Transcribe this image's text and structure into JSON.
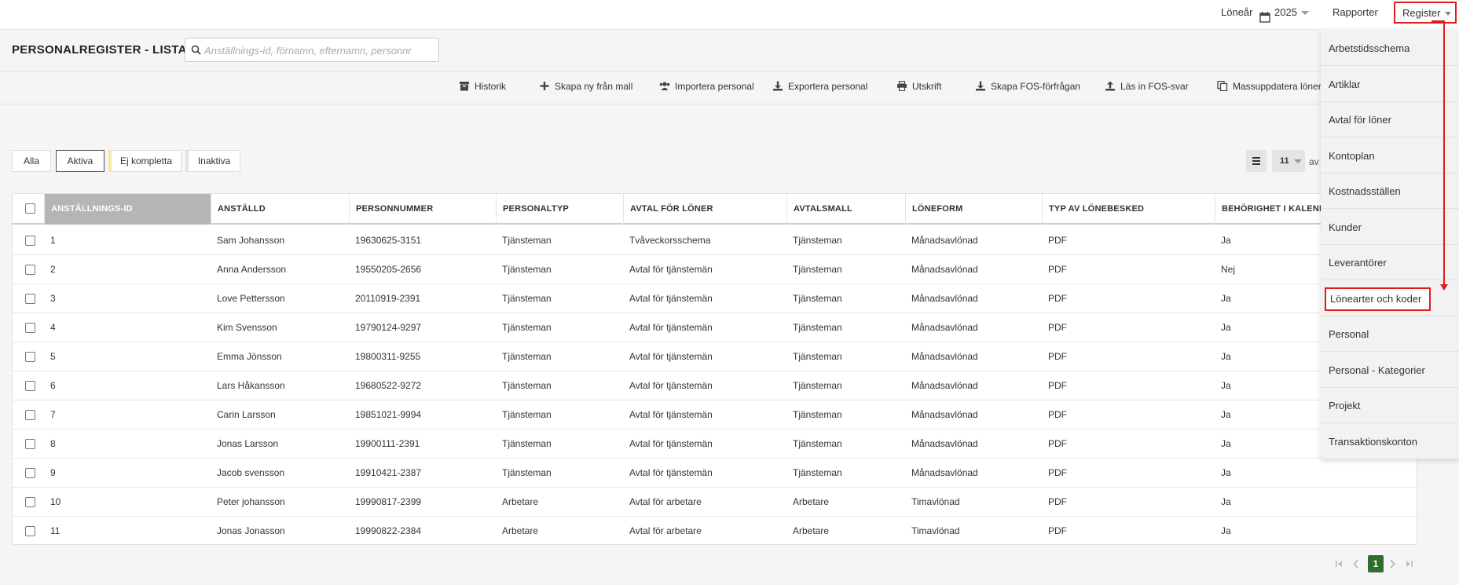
{
  "topbar": {
    "year_label": "Löneår",
    "year_value": "2025",
    "rapporter": "Rapporter",
    "register": "Register"
  },
  "page": {
    "title": "PERSONALREGISTER - LISTA",
    "search_placeholder": "Anställnings-id, förnamn, efternamn, personnr"
  },
  "toolbar": {
    "historik": "Historik",
    "skapa_ny": "Skapa ny från mall",
    "importera": "Importera personal",
    "exportera": "Exportera personal",
    "utskrift": "Utskrift",
    "skapa_fos": "Skapa FOS-förfrågan",
    "las_in_fos": "Läs in FOS-svar",
    "massuppdatera": "Massuppdatera löner"
  },
  "filters": {
    "alla": "Alla",
    "aktiva": "Aktiva",
    "ej_kompletta": "Ej kompletta",
    "inaktiva": "Inaktiva"
  },
  "paging_controls": {
    "page_size": "11",
    "of_text": "av"
  },
  "table": {
    "headers": {
      "id": "ANSTÄLLNINGS-ID",
      "anstalld": "ANSTÄLLD",
      "personnummer": "PERSONNUMMER",
      "personaltyp": "PERSONALTYP",
      "avtal": "AVTAL FÖR LÖNER",
      "avtalsmall": "AVTALSMALL",
      "loneform": "LÖNEFORM",
      "typ": "TYP AV LÖNEBESKED",
      "behorighet": "BEHÖRIGHET I KALENDER"
    },
    "rows": [
      {
        "id": "1",
        "name": "Sam Johansson",
        "pnr": "19630625-3151",
        "type": "Tjänsteman",
        "agreement": "Tvåveckorsschema",
        "template": "Tjänsteman",
        "form": "Månadsavlönad",
        "slip": "PDF",
        "access": "Ja"
      },
      {
        "id": "2",
        "name": "Anna Andersson",
        "pnr": "19550205-2656",
        "type": "Tjänsteman",
        "agreement": "Avtal för tjänstemän",
        "template": "Tjänsteman",
        "form": "Månadsavlönad",
        "slip": "PDF",
        "access": "Nej"
      },
      {
        "id": "3",
        "name": "Love Pettersson",
        "pnr": "20110919-2391",
        "type": "Tjänsteman",
        "agreement": "Avtal för tjänstemän",
        "template": "Tjänsteman",
        "form": "Månadsavlönad",
        "slip": "PDF",
        "access": "Ja"
      },
      {
        "id": "4",
        "name": "Kim Svensson",
        "pnr": "19790124-9297",
        "type": "Tjänsteman",
        "agreement": "Avtal för tjänstemän",
        "template": "Tjänsteman",
        "form": "Månadsavlönad",
        "slip": "PDF",
        "access": "Ja"
      },
      {
        "id": "5",
        "name": "Emma Jönsson",
        "pnr": "19800311-9255",
        "type": "Tjänsteman",
        "agreement": "Avtal för tjänstemän",
        "template": "Tjänsteman",
        "form": "Månadsavlönad",
        "slip": "PDF",
        "access": "Ja"
      },
      {
        "id": "6",
        "name": "Lars Håkansson",
        "pnr": "19680522-9272",
        "type": "Tjänsteman",
        "agreement": "Avtal för tjänstemän",
        "template": "Tjänsteman",
        "form": "Månadsavlönad",
        "slip": "PDF",
        "access": "Ja"
      },
      {
        "id": "7",
        "name": "Carin Larsson",
        "pnr": "19851021-9994",
        "type": "Tjänsteman",
        "agreement": "Avtal för tjänstemän",
        "template": "Tjänsteman",
        "form": "Månadsavlönad",
        "slip": "PDF",
        "access": "Ja"
      },
      {
        "id": "8",
        "name": "Jonas Larsson",
        "pnr": "19900111-2391",
        "type": "Tjänsteman",
        "agreement": "Avtal för tjänstemän",
        "template": "Tjänsteman",
        "form": "Månadsavlönad",
        "slip": "PDF",
        "access": "Ja"
      },
      {
        "id": "9",
        "name": "Jacob svensson",
        "pnr": "19910421-2387",
        "type": "Tjänsteman",
        "agreement": "Avtal för tjänstemän",
        "template": "Tjänsteman",
        "form": "Månadsavlönad",
        "slip": "PDF",
        "access": "Ja"
      },
      {
        "id": "10",
        "name": "Peter johansson",
        "pnr": "19990817-2399",
        "type": "Arbetare",
        "agreement": "Avtal för arbetare",
        "template": "Arbetare",
        "form": "Timavlönad",
        "slip": "PDF",
        "access": "Ja"
      },
      {
        "id": "11",
        "name": "Jonas Jonasson",
        "pnr": "19990822-2384",
        "type": "Arbetare",
        "agreement": "Avtal för arbetare",
        "template": "Arbetare",
        "form": "Timavlönad",
        "slip": "PDF",
        "access": "Ja"
      }
    ]
  },
  "pagination": {
    "current": "1"
  },
  "register_menu": {
    "items": [
      "Arbetstidsschema",
      "Artiklar",
      "Avtal för löner",
      "Kontoplan",
      "Kostnadsställen",
      "Kunder",
      "Leverantörer",
      "Lönearter och koder",
      "Personal",
      "Personal - Kategorier",
      "Projekt",
      "Transaktionskonton"
    ]
  },
  "colors": {
    "highlight_red": "#e01d1d",
    "active_page_green": "#2f6e2f",
    "sorted_header_gray": "#b5b5b5"
  }
}
